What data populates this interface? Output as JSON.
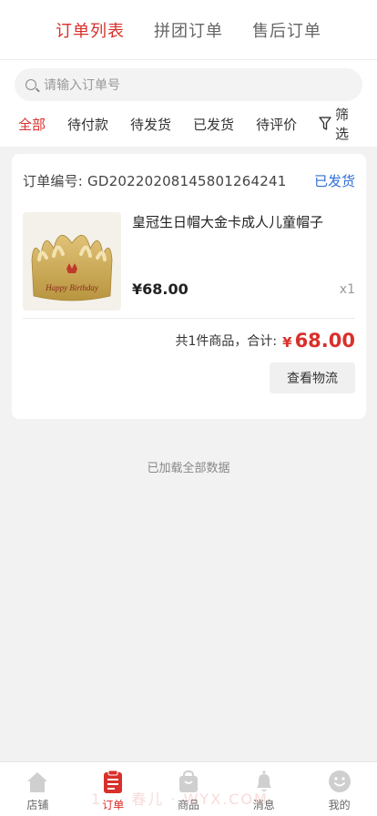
{
  "top_tabs": [
    {
      "label": "订单列表"
    },
    {
      "label": "拼团订单"
    },
    {
      "label": "售后订单"
    }
  ],
  "search": {
    "placeholder": "请输入订单号"
  },
  "status_tabs": [
    {
      "label": "全部"
    },
    {
      "label": "待付款"
    },
    {
      "label": "待发货"
    },
    {
      "label": "已发货"
    },
    {
      "label": "待评价"
    }
  ],
  "filter": {
    "label": "筛选",
    "icon": "filter-icon"
  },
  "order": {
    "number_label": "订单编号:",
    "number": "GD20220208145801264241",
    "status": "已发货",
    "product": {
      "name": "皇冠生日帽大金卡成人儿童帽子",
      "price": "¥68.00",
      "qty": "x1",
      "image_text": "Happy Birthday"
    },
    "summary_text": "共1件商品，合计:",
    "total_symbol": "¥",
    "total": "68.00",
    "action_label": "查看物流"
  },
  "loaded_text": "已加载全部数据",
  "tabbar": [
    {
      "label": "店铺",
      "icon": "home-icon"
    },
    {
      "label": "订单",
      "icon": "order-icon"
    },
    {
      "label": "商品",
      "icon": "bag-icon"
    },
    {
      "label": "消息",
      "icon": "bell-icon"
    },
    {
      "label": "我的",
      "icon": "smile-icon"
    }
  ],
  "watermark": "1 … 春儿 · WYX.COM",
  "colors": {
    "accent": "#d9302b",
    "status_blue": "#2e6fd6"
  }
}
